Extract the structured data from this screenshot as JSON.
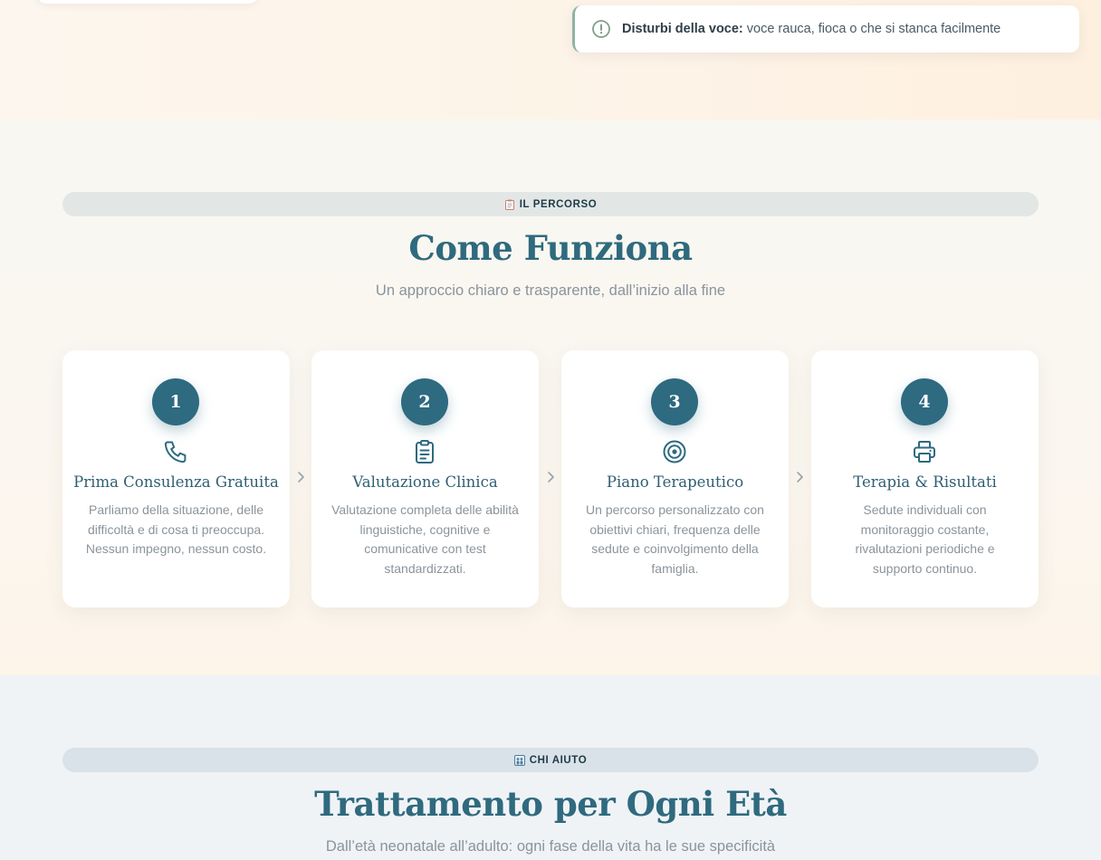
{
  "notice": {
    "label": "Disturbi della voce:",
    "text": "voce rauca, fioca o che si stanca facilmente",
    "icon": "alert-circle-icon"
  },
  "process": {
    "badge_icon": "clipboard-icon",
    "badge": "IL PERCORSO",
    "title": "Come Funziona",
    "subtitle": "Un approccio chiaro e trasparente, dall’inizio alla fine",
    "steps": [
      {
        "number": "1",
        "icon": "phone-icon",
        "title": "Prima Consulenza Gratuita",
        "description": "Parliamo della situazione, delle difficoltà e di cosa ti preoccupa. Nessun impegno, nessun costo."
      },
      {
        "number": "2",
        "icon": "clipboard-list-icon",
        "title": "Valutazione Clinica",
        "description": "Valutazione completa delle abilità linguistiche, cognitive e comunicative con test standardizzati."
      },
      {
        "number": "3",
        "icon": "target-icon",
        "title": "Piano Terapeutico",
        "description": "Un percorso personalizzato con obiettivi chiari, frequenza delle sedute e coinvolgimento della famiglia."
      },
      {
        "number": "4",
        "icon": "printer-icon",
        "title": "Terapia & Risultati",
        "description": "Sedute individuali con monitoraggio costante, rivalutazioni periodiche e supporto continuo."
      }
    ]
  },
  "who": {
    "badge_icon": "family-icon",
    "badge": "CHI AIUTO",
    "title": "Trattamento per Ogni Età",
    "subtitle": "Dall’età neonatale all’adulto: ogni fase della vita ha le sue specificità"
  },
  "colors": {
    "accent": "#2e6a80",
    "title": "#2f6a7e",
    "notice_border": "#8fb4a0"
  }
}
